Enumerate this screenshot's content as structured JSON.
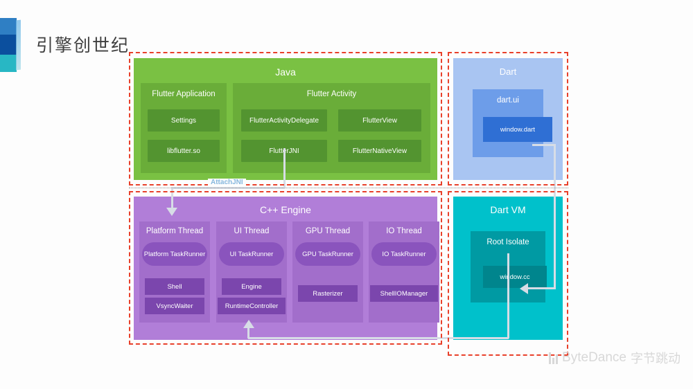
{
  "slide": {
    "title": "引擎创世纪",
    "logo_name": "bytedance-stripes-logo"
  },
  "divider": {
    "label": "AttachJNI"
  },
  "java": {
    "title": "Java",
    "groups": [
      {
        "title": "Flutter Application",
        "cells": [
          "Settings",
          "libflutter.so"
        ]
      },
      {
        "title": "Flutter Activity",
        "cells": [
          "FlutterActivityDelegate",
          "FlutterView",
          "FlutterJNI",
          "FlutterNativeView"
        ]
      }
    ]
  },
  "dart": {
    "title": "Dart",
    "inner_title": "dart.ui",
    "leaf": "window.dart"
  },
  "cpp": {
    "title": "C++ Engine",
    "threads": [
      {
        "title": "Platform Thread",
        "runner": "Platform TaskRunner",
        "boxes": [
          "Shell",
          "VsyncWaiter"
        ]
      },
      {
        "title": "UI Thread",
        "runner": "UI TaskRunner",
        "boxes": [
          "Engine",
          "RuntimeController"
        ]
      },
      {
        "title": "GPU Thread",
        "runner": "GPU TaskRunner",
        "boxes": [
          "Rasterizer"
        ]
      },
      {
        "title": "IO Thread",
        "runner": "IO TaskRunner",
        "boxes": [
          "ShellIOManager"
        ]
      }
    ]
  },
  "dartvm": {
    "title": "Dart VM",
    "inner_title": "Root Isolate",
    "leaf": "window.cc"
  },
  "watermark": {
    "brand": "ByteDance",
    "brand_cn": "字节跳动"
  },
  "colors": {
    "java_outer": "#7ac143",
    "java_mid": "#6aad39",
    "java_inner": "#539430",
    "dart_outer": "#a9c5f2",
    "dart_mid": "#6d9de9",
    "dart_inner": "#2f6fd4",
    "cpp_outer": "#b17ed8",
    "cpp_mid": "#a26ecb",
    "cpp_runner": "#8a54bd",
    "cpp_inner": "#7b46ad",
    "vm_outer": "#00c1cb",
    "vm_mid": "#009aa3",
    "vm_inner": "#00858d",
    "frame_red": "#e8402a",
    "attachjni_blue": "#86b7dd",
    "connector": "#d7dde6"
  }
}
